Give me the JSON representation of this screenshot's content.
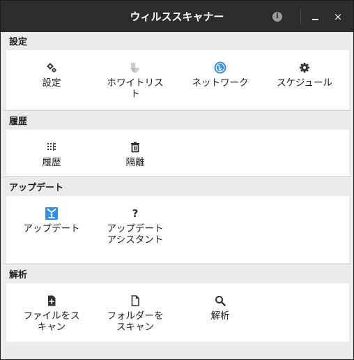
{
  "window": {
    "title": "ウィルススキャナー",
    "close_label": "×"
  },
  "sections": [
    {
      "header": "設定",
      "items": [
        {
          "label": "設定",
          "icon": "gears-icon"
        },
        {
          "label": "ホワイトリスト",
          "label_lines": [
            "ホワイトリス",
            "ト"
          ],
          "icon": "shield-icon"
        },
        {
          "label": "ネットワーク",
          "icon": "globe-icon"
        },
        {
          "label": "スケジュール",
          "icon": "gear-icon"
        }
      ]
    },
    {
      "header": "履歴",
      "items": [
        {
          "label": "履歴",
          "icon": "history-list-icon"
        },
        {
          "label": "隔離",
          "icon": "trash-icon"
        }
      ]
    },
    {
      "header": "アップデート",
      "items": [
        {
          "label": "アップデート",
          "icon": "update-download-icon"
        },
        {
          "label": "アップデートアシスタント",
          "label_lines": [
            "アップデート",
            "アシスタント"
          ],
          "icon": "help-question-icon"
        }
      ]
    },
    {
      "header": "解析",
      "items": [
        {
          "label": "ファイルをスキャン",
          "label_lines": [
            "ファイルをス",
            "キャン"
          ],
          "icon": "file-add-icon"
        },
        {
          "label": "フォルダーをスキャン",
          "label_lines": [
            "フォルダーを",
            "スキャン"
          ],
          "icon": "file-outline-icon"
        },
        {
          "label": "解析",
          "icon": "search-icon"
        }
      ]
    }
  ],
  "colors": {
    "titlebar": "#2d2d2d",
    "background": "#ebebeb",
    "panel": "#ffffff",
    "accent_blue": "#3b8ee8"
  }
}
